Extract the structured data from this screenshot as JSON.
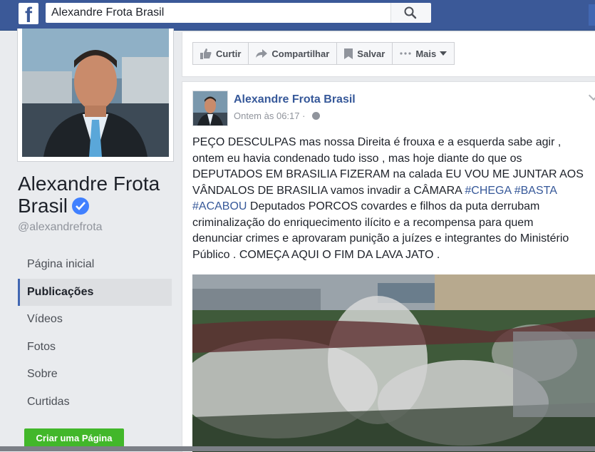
{
  "topbar": {
    "logo": "f",
    "search_value": "Alexandre Frota Brasil",
    "search_icon": "search-icon"
  },
  "profile": {
    "name": "Alexandre Frota Brasil",
    "handle": "@alexandrefrota",
    "verified_icon": "verified-badge-icon"
  },
  "nav": {
    "items": [
      {
        "label": "Página inicial",
        "active": false
      },
      {
        "label": "Publicações",
        "active": true
      },
      {
        "label": "Vídeos",
        "active": false
      },
      {
        "label": "Fotos",
        "active": false
      },
      {
        "label": "Sobre",
        "active": false
      },
      {
        "label": "Curtidas",
        "active": false
      }
    ],
    "create_page": "Criar uma Página"
  },
  "actions": {
    "like": "Curtir",
    "share": "Compartilhar",
    "save": "Salvar",
    "more": "Mais"
  },
  "post": {
    "author": "Alexandre Frota Brasil",
    "time": "Ontem às 06:17",
    "dot": "·",
    "text_1": "PEÇO DESCULPAS mas nossa Direita é frouxa e a esquerda sabe agir , ontem eu havia condenado tudo isso , mas hoje diante do que os DEPUTADOS EM BRASILIA FIZERAM na calada EU VOU ME JUNTAR AOS VÂNDALOS DE BRASILIA vamos invadir a CÂMARA ",
    "tag_1": "#CHEGA",
    "tag_2": "#BASTA",
    "tag_3": "#ACABOU",
    "text_2": " Deputados PORCOS covardes e filhos da puta derrubam criminalização do enriquecimento ilícito e a recompensa para quem denunciar crimes e aprovaram punição a juízes e integrantes do Ministério Público . COMEÇA AQUI O FIM DA LAVA JATO ."
  },
  "colors": {
    "brand": "#3b5998",
    "link": "#365899",
    "create_button": "#42b72a"
  }
}
